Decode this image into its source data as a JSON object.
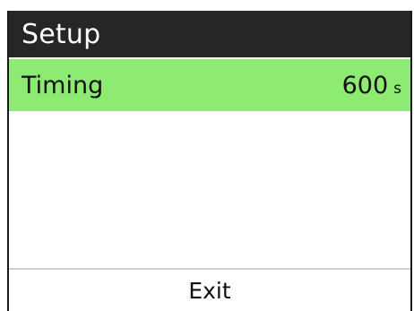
{
  "header": {
    "title": "Setup"
  },
  "menu": {
    "items": [
      {
        "label": "Timing",
        "value": "600",
        "unit": "s",
        "selected": true
      }
    ]
  },
  "footer": {
    "exit_label": "Exit"
  },
  "colors": {
    "header_bg": "#262626",
    "selected_bg": "#8deb73"
  }
}
